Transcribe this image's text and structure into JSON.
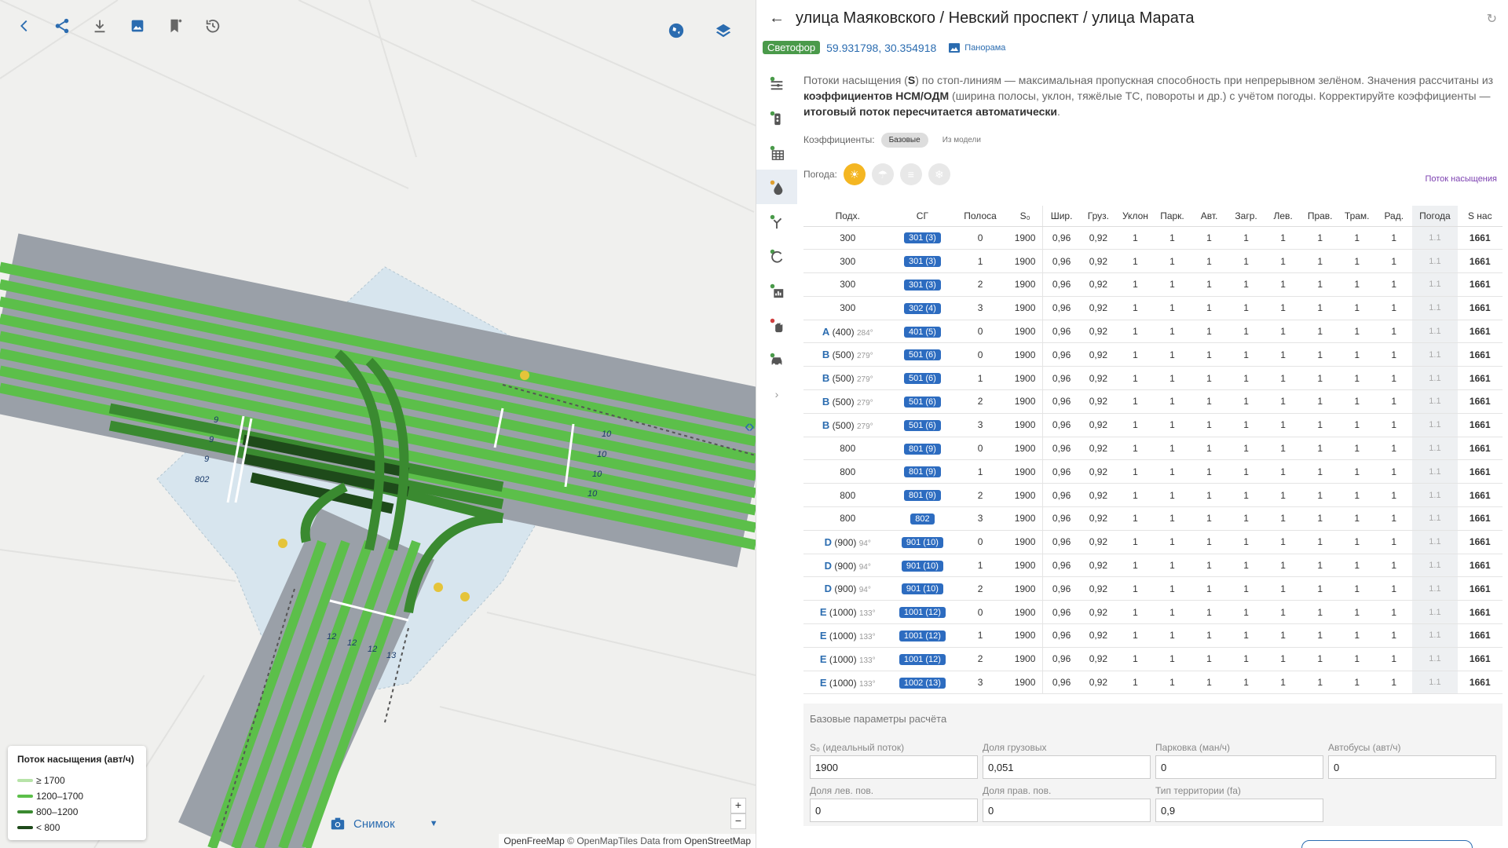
{
  "map": {
    "legend": {
      "title": "Поток насыщения (авт/ч)",
      "items": [
        {
          "label": "≥ 1700",
          "color": "#b7e3a8"
        },
        {
          "label": "1200–1700",
          "color": "#5cbf4a"
        },
        {
          "label": "800–1200",
          "color": "#3a8a30"
        },
        {
          "label": "< 800",
          "color": "#1e4a1a"
        }
      ]
    },
    "snapshot_label": "Снимок",
    "zoom_in": "+",
    "zoom_out": "−",
    "attribution": {
      "a": "OpenFreeMap",
      "b": "© OpenMapTiles",
      "c": "Data from",
      "d": "OpenStreetMap"
    },
    "lane_labels": [
      {
        "text": "9"
      },
      {
        "text": "9"
      },
      {
        "text": "9"
      },
      {
        "text": "802"
      },
      {
        "text": "10"
      },
      {
        "text": "10"
      },
      {
        "text": "10"
      },
      {
        "text": "10"
      },
      {
        "text": "12"
      },
      {
        "text": "12"
      },
      {
        "text": "12"
      },
      {
        "text": "13"
      }
    ]
  },
  "panel": {
    "title": "улица Маяковского / Невский проспект / улица Марата",
    "badge": "Светофор",
    "coords": "59.931798, 30.354918",
    "panorama": "Панорама",
    "desc": {
      "p1": "Потоки насыщения (",
      "s": "S",
      "p2": ") по стоп-линиям — максимальная пропускная способность при непрерывном зелёном. Значения рассчитаны из ",
      "b1": "коэффициентов НСМ/ОДМ",
      "p3": " (ширина полосы, уклон, тяжёлые ТС, повороты и др.) с учётом погоды. Корректируйте коэффициенты — ",
      "b2": "итоговый поток пересчитается автоматически",
      "p4": "."
    },
    "coef_label": "Коэффициенты:",
    "coef_options": [
      "Базовые",
      "Из модели"
    ],
    "weather_label": "Погода:",
    "flow_link": "Поток насыщения",
    "table": {
      "headers": [
        "Подх.",
        "СГ",
        "Полоса",
        "S₀",
        "Шир.",
        "Груз.",
        "Уклон",
        "Парк.",
        "Авт.",
        "Загр.",
        "Лев.",
        "Прав.",
        "Трам.",
        "Рад.",
        "Погода",
        "S нас"
      ],
      "rows": [
        {
          "ap": "",
          "apn": "300",
          "ang": "",
          "sg": "301 (3)",
          "lane": "0",
          "s0": "1900",
          "w": "0,96",
          "g": "0,92",
          "u": "1",
          "p": "1",
          "a": "1",
          "z": "1",
          "l": "1",
          "r": "1",
          "t": "1",
          "rd": "1",
          "wt": "1.1",
          "s": "1661"
        },
        {
          "ap": "",
          "apn": "300",
          "ang": "",
          "sg": "301 (3)",
          "lane": "1",
          "s0": "1900",
          "w": "0,96",
          "g": "0,92",
          "u": "1",
          "p": "1",
          "a": "1",
          "z": "1",
          "l": "1",
          "r": "1",
          "t": "1",
          "rd": "1",
          "wt": "1.1",
          "s": "1661"
        },
        {
          "ap": "",
          "apn": "300",
          "ang": "",
          "sg": "301 (3)",
          "lane": "2",
          "s0": "1900",
          "w": "0,96",
          "g": "0,92",
          "u": "1",
          "p": "1",
          "a": "1",
          "z": "1",
          "l": "1",
          "r": "1",
          "t": "1",
          "rd": "1",
          "wt": "1.1",
          "s": "1661"
        },
        {
          "ap": "",
          "apn": "300",
          "ang": "",
          "sg": "302 (4)",
          "lane": "3",
          "s0": "1900",
          "w": "0,96",
          "g": "0,92",
          "u": "1",
          "p": "1",
          "a": "1",
          "z": "1",
          "l": "1",
          "r": "1",
          "t": "1",
          "rd": "1",
          "wt": "1.1",
          "s": "1661"
        },
        {
          "ap": "A",
          "apn": "(400)",
          "ang": "284°",
          "sg": "401 (5)",
          "lane": "0",
          "s0": "1900",
          "w": "0,96",
          "g": "0,92",
          "u": "1",
          "p": "1",
          "a": "1",
          "z": "1",
          "l": "1",
          "r": "1",
          "t": "1",
          "rd": "1",
          "wt": "1.1",
          "s": "1661"
        },
        {
          "ap": "B",
          "apn": "(500)",
          "ang": "279°",
          "sg": "501 (6)",
          "lane": "0",
          "s0": "1900",
          "w": "0,96",
          "g": "0,92",
          "u": "1",
          "p": "1",
          "a": "1",
          "z": "1",
          "l": "1",
          "r": "1",
          "t": "1",
          "rd": "1",
          "wt": "1.1",
          "s": "1661"
        },
        {
          "ap": "B",
          "apn": "(500)",
          "ang": "279°",
          "sg": "501 (6)",
          "lane": "1",
          "s0": "1900",
          "w": "0,96",
          "g": "0,92",
          "u": "1",
          "p": "1",
          "a": "1",
          "z": "1",
          "l": "1",
          "r": "1",
          "t": "1",
          "rd": "1",
          "wt": "1.1",
          "s": "1661"
        },
        {
          "ap": "B",
          "apn": "(500)",
          "ang": "279°",
          "sg": "501 (6)",
          "lane": "2",
          "s0": "1900",
          "w": "0,96",
          "g": "0,92",
          "u": "1",
          "p": "1",
          "a": "1",
          "z": "1",
          "l": "1",
          "r": "1",
          "t": "1",
          "rd": "1",
          "wt": "1.1",
          "s": "1661"
        },
        {
          "ap": "B",
          "apn": "(500)",
          "ang": "279°",
          "sg": "501 (6)",
          "lane": "3",
          "s0": "1900",
          "w": "0,96",
          "g": "0,92",
          "u": "1",
          "p": "1",
          "a": "1",
          "z": "1",
          "l": "1",
          "r": "1",
          "t": "1",
          "rd": "1",
          "wt": "1.1",
          "s": "1661"
        },
        {
          "ap": "",
          "apn": "800",
          "ang": "",
          "sg": "801 (9)",
          "lane": "0",
          "s0": "1900",
          "w": "0,96",
          "g": "0,92",
          "u": "1",
          "p": "1",
          "a": "1",
          "z": "1",
          "l": "1",
          "r": "1",
          "t": "1",
          "rd": "1",
          "wt": "1.1",
          "s": "1661"
        },
        {
          "ap": "",
          "apn": "800",
          "ang": "",
          "sg": "801 (9)",
          "lane": "1",
          "s0": "1900",
          "w": "0,96",
          "g": "0,92",
          "u": "1",
          "p": "1",
          "a": "1",
          "z": "1",
          "l": "1",
          "r": "1",
          "t": "1",
          "rd": "1",
          "wt": "1.1",
          "s": "1661"
        },
        {
          "ap": "",
          "apn": "800",
          "ang": "",
          "sg": "801 (9)",
          "lane": "2",
          "s0": "1900",
          "w": "0,96",
          "g": "0,92",
          "u": "1",
          "p": "1",
          "a": "1",
          "z": "1",
          "l": "1",
          "r": "1",
          "t": "1",
          "rd": "1",
          "wt": "1.1",
          "s": "1661"
        },
        {
          "ap": "",
          "apn": "800",
          "ang": "",
          "sg": "802",
          "lane": "3",
          "s0": "1900",
          "w": "0,96",
          "g": "0,92",
          "u": "1",
          "p": "1",
          "a": "1",
          "z": "1",
          "l": "1",
          "r": "1",
          "t": "1",
          "rd": "1",
          "wt": "1.1",
          "s": "1661"
        },
        {
          "ap": "D",
          "apn": "(900)",
          "ang": "94°",
          "sg": "901 (10)",
          "lane": "0",
          "s0": "1900",
          "w": "0,96",
          "g": "0,92",
          "u": "1",
          "p": "1",
          "a": "1",
          "z": "1",
          "l": "1",
          "r": "1",
          "t": "1",
          "rd": "1",
          "wt": "1.1",
          "s": "1661"
        },
        {
          "ap": "D",
          "apn": "(900)",
          "ang": "94°",
          "sg": "901 (10)",
          "lane": "1",
          "s0": "1900",
          "w": "0,96",
          "g": "0,92",
          "u": "1",
          "p": "1",
          "a": "1",
          "z": "1",
          "l": "1",
          "r": "1",
          "t": "1",
          "rd": "1",
          "wt": "1.1",
          "s": "1661"
        },
        {
          "ap": "D",
          "apn": "(900)",
          "ang": "94°",
          "sg": "901 (10)",
          "lane": "2",
          "s0": "1900",
          "w": "0,96",
          "g": "0,92",
          "u": "1",
          "p": "1",
          "a": "1",
          "z": "1",
          "l": "1",
          "r": "1",
          "t": "1",
          "rd": "1",
          "wt": "1.1",
          "s": "1661"
        },
        {
          "ap": "E",
          "apn": "(1000)",
          "ang": "133°",
          "sg": "1001 (12)",
          "lane": "0",
          "s0": "1900",
          "w": "0,96",
          "g": "0,92",
          "u": "1",
          "p": "1",
          "a": "1",
          "z": "1",
          "l": "1",
          "r": "1",
          "t": "1",
          "rd": "1",
          "wt": "1.1",
          "s": "1661"
        },
        {
          "ap": "E",
          "apn": "(1000)",
          "ang": "133°",
          "sg": "1001 (12)",
          "lane": "1",
          "s0": "1900",
          "w": "0,96",
          "g": "0,92",
          "u": "1",
          "p": "1",
          "a": "1",
          "z": "1",
          "l": "1",
          "r": "1",
          "t": "1",
          "rd": "1",
          "wt": "1.1",
          "s": "1661"
        },
        {
          "ap": "E",
          "apn": "(1000)",
          "ang": "133°",
          "sg": "1001 (12)",
          "lane": "2",
          "s0": "1900",
          "w": "0,96",
          "g": "0,92",
          "u": "1",
          "p": "1",
          "a": "1",
          "z": "1",
          "l": "1",
          "r": "1",
          "t": "1",
          "rd": "1",
          "wt": "1.1",
          "s": "1661"
        },
        {
          "ap": "E",
          "apn": "(1000)",
          "ang": "133°",
          "sg": "1002 (13)",
          "lane": "3",
          "s0": "1900",
          "w": "0,96",
          "g": "0,92",
          "u": "1",
          "p": "1",
          "a": "1",
          "z": "1",
          "l": "1",
          "r": "1",
          "t": "1",
          "rd": "1",
          "wt": "1.1",
          "s": "1661"
        }
      ]
    },
    "base": {
      "title": "Базовые параметры расчёта",
      "fields": [
        {
          "label": "S₀ (идеальный поток)",
          "value": "1900"
        },
        {
          "label": "Доля грузовых",
          "value": "0,051"
        },
        {
          "label": "Парковка (ман/ч)",
          "value": "0"
        },
        {
          "label": "Автобусы (авт/ч)",
          "value": "0"
        },
        {
          "label": "Доля лев. пов.",
          "value": "0"
        },
        {
          "label": "Доля прав. пов.",
          "value": "0"
        },
        {
          "label": "Тип территории (fa)",
          "value": "0,9"
        }
      ]
    }
  },
  "colors": {
    "accent": "#2b6cb0",
    "badge": "#4a9a4a",
    "sg": "#2d6cc0",
    "lane_light": "#5cbf4a",
    "lane_dark": "#1e4a1a"
  }
}
